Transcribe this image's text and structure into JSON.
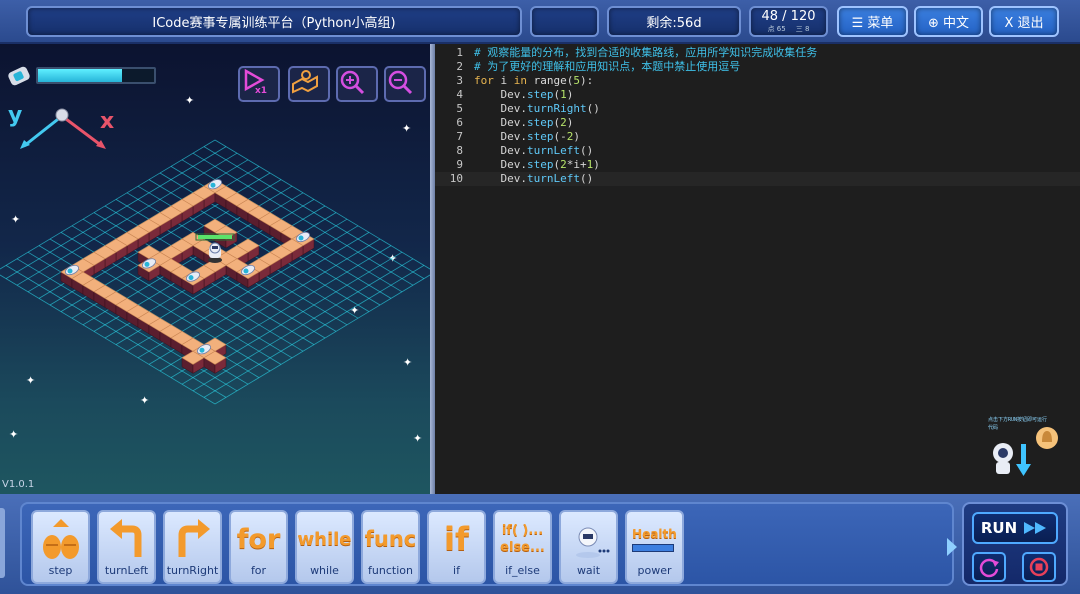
{
  "header": {
    "title": "ICode赛事专属训练平台（Python小高组)",
    "remaining": "剩余:56d",
    "progress": "48 / 120",
    "progress_sub_a": "点 65",
    "progress_sub_b": "三 8",
    "menu_label": "☰ 菜单",
    "lang_label": "⊕ 中文",
    "exit_label": "X 退出"
  },
  "game": {
    "version": "V1.0.1",
    "energy_fraction": 0.72,
    "axis_y": "y",
    "axis_x": "x",
    "tools": [
      "speed-icon",
      "map-icon",
      "zoom-in-icon",
      "zoom-out-icon"
    ]
  },
  "editor": {
    "lines": [
      {
        "n": "1",
        "text": "# 观察能量的分布，找到合适的收集路线，应用所学知识完成收集任务"
      },
      {
        "n": "2",
        "text": "# 为了更好的理解和应用知识点，本题中禁止使用逗号"
      },
      {
        "n": "3",
        "text": "for i in range(5):"
      },
      {
        "n": "4",
        "text": "    Dev.step(1)"
      },
      {
        "n": "5",
        "text": "    Dev.turnRight()"
      },
      {
        "n": "6",
        "text": "    Dev.step(2)"
      },
      {
        "n": "7",
        "text": "    Dev.step(-2)"
      },
      {
        "n": "8",
        "text": "    Dev.turnLeft()"
      },
      {
        "n": "9",
        "text": "    Dev.step(2*i+1)"
      },
      {
        "n": "10",
        "text": "    Dev.turnLeft()"
      }
    ],
    "active_line": 10,
    "tip_text": "点击下方RUN按钮即可运行代码"
  },
  "blocks": [
    {
      "label": "step",
      "icon": "step-icon"
    },
    {
      "label": "turnLeft",
      "icon": "turn-left-icon"
    },
    {
      "label": "turnRight",
      "icon": "turn-right-icon"
    },
    {
      "label": "for",
      "icon": "for-icon",
      "glyph": "for"
    },
    {
      "label": "while",
      "icon": "while-icon",
      "glyph": "while"
    },
    {
      "label": "function",
      "icon": "function-icon",
      "glyph": "func"
    },
    {
      "label": "if",
      "icon": "if-icon",
      "glyph": "if"
    },
    {
      "label": "if_else",
      "icon": "if-else-icon",
      "glyph": "if()..."
    },
    {
      "label": "wait",
      "icon": "wait-icon"
    },
    {
      "label": "power",
      "icon": "power-icon",
      "glyph": "Health"
    }
  ],
  "run": {
    "run_label": "RUN"
  },
  "colors": {
    "accent": "#3b7fe0",
    "block_orange": "#f39a2c",
    "grid": "#2ad3e6",
    "tile_top": "#f2b07c",
    "tile_side": "#5a1e2e"
  }
}
